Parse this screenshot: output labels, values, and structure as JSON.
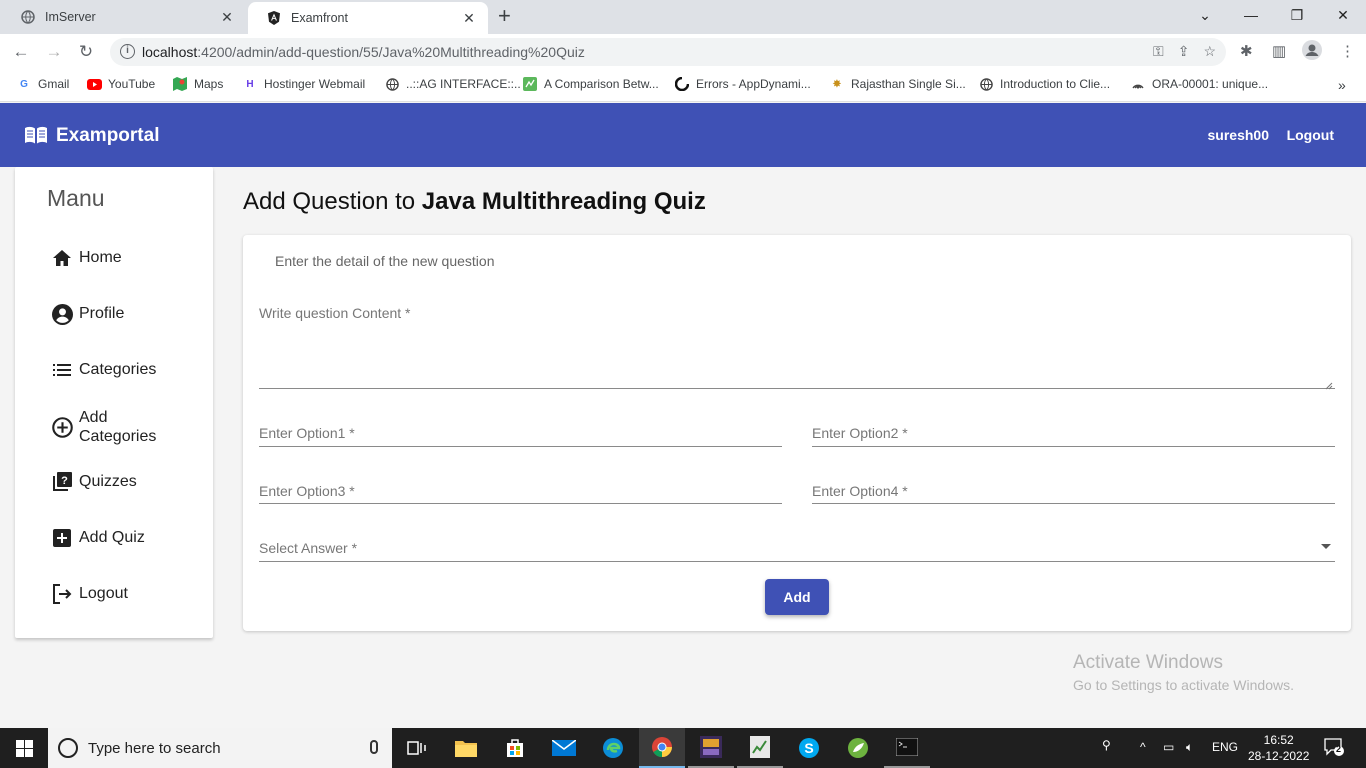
{
  "browser": {
    "tabs": [
      {
        "title": "ImServer",
        "active": false
      },
      {
        "title": "Examfront",
        "active": true
      }
    ],
    "url_host": "localhost",
    "url_path": ":4200/admin/add-question/55/Java%20Multithreading%20Quiz",
    "bookmarks": [
      {
        "label": "Gmail",
        "icon": "gmail-icon"
      },
      {
        "label": "YouTube",
        "icon": "youtube-icon"
      },
      {
        "label": "Maps",
        "icon": "maps-icon"
      },
      {
        "label": "Hostinger Webmail",
        "icon": "hostinger-icon"
      },
      {
        "label": "..::AG INTERFACE::..",
        "icon": "globe-icon"
      },
      {
        "label": "A Comparison Betw...",
        "icon": "doc-icon"
      },
      {
        "label": "Errors - AppDynami...",
        "icon": "appdynamics-icon"
      },
      {
        "label": "Rajasthan Single Si...",
        "icon": "emblem-icon"
      },
      {
        "label": "Introduction to Clie...",
        "icon": "globe-icon"
      },
      {
        "label": "ORA-00001: unique...",
        "icon": "oracle-icon"
      }
    ]
  },
  "app": {
    "title": "Examportal",
    "user": "suresh00",
    "logout": "Logout",
    "brand_color": "#3f51b5"
  },
  "sidebar": {
    "title": "Manu",
    "items": [
      {
        "label": "Home",
        "icon": "home-icon"
      },
      {
        "label": "Profile",
        "icon": "account-circle-icon"
      },
      {
        "label": "Categories",
        "icon": "list-icon"
      },
      {
        "label": "Add Categories",
        "icon": "add-circle-icon"
      },
      {
        "label": "Quizzes",
        "icon": "quiz-icon"
      },
      {
        "label": "Add Quiz",
        "icon": "add-box-icon"
      },
      {
        "label": "Logout",
        "icon": "logout-icon"
      }
    ]
  },
  "main": {
    "title_prefix": "Add Question to",
    "quiz_name": "Java Multithreading Quiz",
    "subtitle": "Enter the detail of the new question",
    "content_placeholder": "Write question Content *",
    "option1_placeholder": "Enter Option1 *",
    "option2_placeholder": "Enter Option2 *",
    "option3_placeholder": "Enter Option3 *",
    "option4_placeholder": "Enter Option4 *",
    "answer_placeholder": "Select Answer *",
    "add_button": "Add"
  },
  "watermark": {
    "line1": "Activate Windows",
    "line2": "Go to Settings to activate Windows."
  },
  "taskbar": {
    "search_text": "Type here to search",
    "lang": "ENG",
    "time": "16:52",
    "date": "28-12-2022",
    "notifications": "2"
  }
}
